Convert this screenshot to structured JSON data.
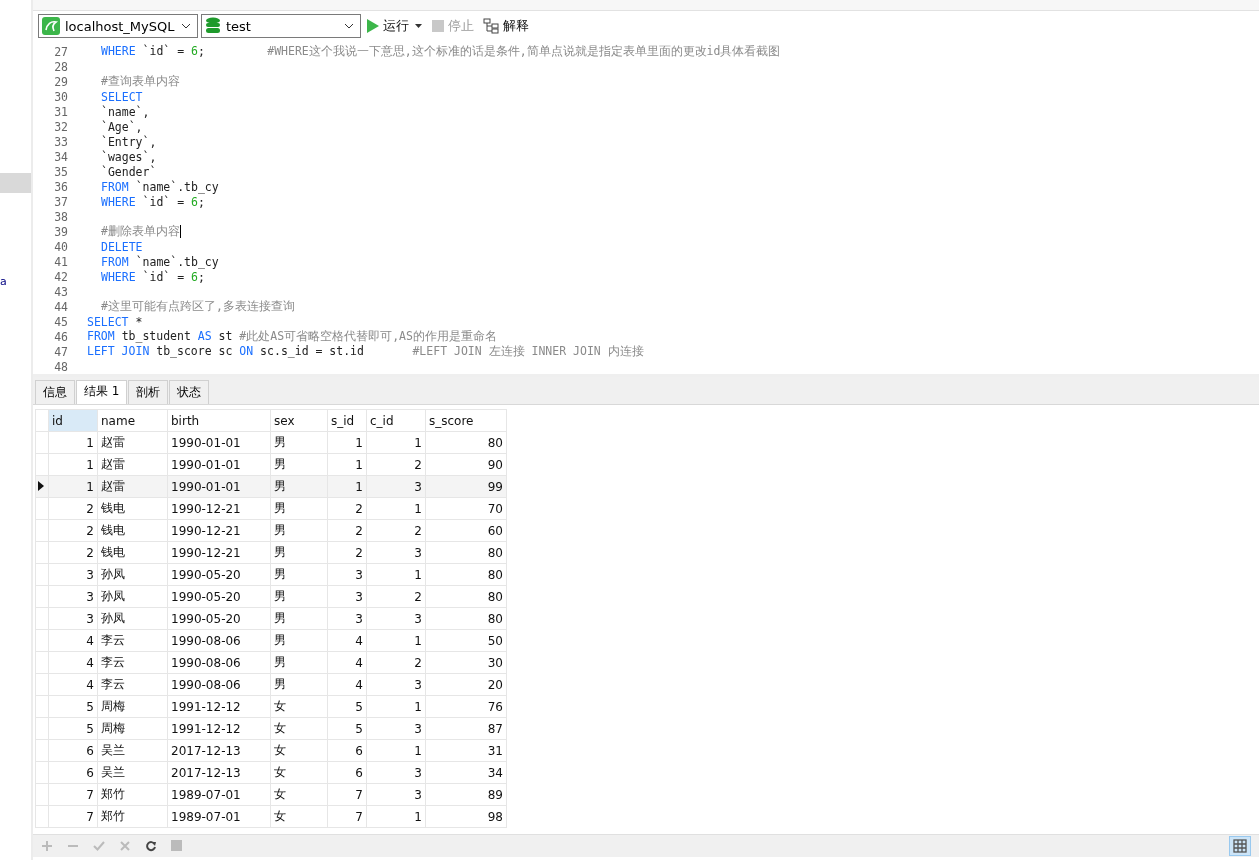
{
  "sidebar": {
    "fragment": "a"
  },
  "toolbar": {
    "connection": "localhost_MySQL",
    "database": "test",
    "run": "运行",
    "stop": "停止",
    "explain": "解释"
  },
  "editor": {
    "lines": [
      {
        "no": "27",
        "indent": true,
        "tokens": [
          {
            "kind": "keyword",
            "text": "WHERE"
          },
          {
            "kind": "plain",
            "text": " `id` = "
          },
          {
            "kind": "number",
            "text": "6"
          },
          {
            "kind": "plain",
            "text": ";         "
          },
          {
            "kind": "comment",
            "text": "#WHERE这个我说一下意思,这个标准的话是条件,简单点说就是指定表单里面的更改id具体看截图"
          }
        ]
      },
      {
        "no": "28"
      },
      {
        "no": "29",
        "indent": true,
        "tokens": [
          {
            "kind": "comment",
            "text": "#查询表单内容"
          }
        ]
      },
      {
        "no": "30",
        "indent": true,
        "tokens": [
          {
            "kind": "keyword",
            "text": "SELECT"
          }
        ]
      },
      {
        "no": "31",
        "indent": true,
        "tokens": [
          {
            "kind": "plain",
            "text": "`name`,"
          }
        ]
      },
      {
        "no": "32",
        "indent": true,
        "tokens": [
          {
            "kind": "plain",
            "text": "`Age`,"
          }
        ]
      },
      {
        "no": "33",
        "indent": true,
        "tokens": [
          {
            "kind": "plain",
            "text": "`Entry`,"
          }
        ]
      },
      {
        "no": "34",
        "indent": true,
        "tokens": [
          {
            "kind": "plain",
            "text": "`wages`,"
          }
        ]
      },
      {
        "no": "35",
        "indent": true,
        "tokens": [
          {
            "kind": "plain",
            "text": "`Gender`"
          }
        ]
      },
      {
        "no": "36",
        "indent": true,
        "tokens": [
          {
            "kind": "keyword",
            "text": "FROM"
          },
          {
            "kind": "plain",
            "text": " `name`.tb_cy"
          }
        ]
      },
      {
        "no": "37",
        "indent": true,
        "tokens": [
          {
            "kind": "keyword",
            "text": "WHERE"
          },
          {
            "kind": "plain",
            "text": " `id` = "
          },
          {
            "kind": "number",
            "text": "6"
          },
          {
            "kind": "plain",
            "text": ";"
          }
        ]
      },
      {
        "no": "38"
      },
      {
        "no": "39",
        "indent": true,
        "cursor": true,
        "tokens": [
          {
            "kind": "comment",
            "text": "#删除表单内容"
          }
        ]
      },
      {
        "no": "40",
        "indent": true,
        "tokens": [
          {
            "kind": "keyword",
            "text": "DELETE"
          }
        ]
      },
      {
        "no": "41",
        "indent": true,
        "tokens": [
          {
            "kind": "keyword",
            "text": "FROM"
          },
          {
            "kind": "plain",
            "text": " `name`.tb_cy"
          }
        ]
      },
      {
        "no": "42",
        "indent": true,
        "tokens": [
          {
            "kind": "keyword",
            "text": "WHERE"
          },
          {
            "kind": "plain",
            "text": " `id` = "
          },
          {
            "kind": "number",
            "text": "6"
          },
          {
            "kind": "plain",
            "text": ";"
          }
        ]
      },
      {
        "no": "43"
      },
      {
        "no": "44",
        "indent": true,
        "tokens": [
          {
            "kind": "comment",
            "text": "#这里可能有点跨区了,多表连接查询"
          }
        ]
      },
      {
        "no": "45",
        "indent": false,
        "tokens": [
          {
            "kind": "keyword",
            "text": "SELECT"
          },
          {
            "kind": "plain",
            "text": " *"
          }
        ]
      },
      {
        "no": "46",
        "indent": false,
        "tokens": [
          {
            "kind": "keyword",
            "text": "FROM"
          },
          {
            "kind": "plain",
            "text": " tb_student "
          },
          {
            "kind": "keyword",
            "text": "AS"
          },
          {
            "kind": "plain",
            "text": " st "
          },
          {
            "kind": "comment",
            "text": "#此处AS可省略空格代替即可,AS的作用是重命名"
          }
        ]
      },
      {
        "no": "47",
        "indent": false,
        "tokens": [
          {
            "kind": "keyword",
            "text": "LEFT JOIN"
          },
          {
            "kind": "plain",
            "text": " tb_score sc "
          },
          {
            "kind": "keyword",
            "text": "ON"
          },
          {
            "kind": "plain",
            "text": " sc.s_id = st.id       "
          },
          {
            "kind": "comment",
            "text": "#LEFT JOIN 左连接 INNER JOIN 内连接"
          }
        ]
      },
      {
        "no": "48"
      }
    ]
  },
  "tabs": [
    {
      "label": "信息",
      "selected": false
    },
    {
      "label": "结果 1",
      "selected": true
    },
    {
      "label": "剖析",
      "selected": false
    },
    {
      "label": "状态",
      "selected": false
    }
  ],
  "table": {
    "columns": [
      {
        "label": "id",
        "kind": "number",
        "selected": true
      },
      {
        "label": "name",
        "kind": "text",
        "selected": false
      },
      {
        "label": "birth",
        "kind": "text",
        "selected": false
      },
      {
        "label": "sex",
        "kind": "text",
        "selected": false
      },
      {
        "label": "s_id",
        "kind": "number",
        "selected": false
      },
      {
        "label": "c_id",
        "kind": "number",
        "selected": false
      },
      {
        "label": "s_score",
        "kind": "number",
        "selected": false
      }
    ],
    "rows": [
      {
        "selected": false,
        "cells": [
          "1",
          "赵雷",
          "1990-01-01",
          "男",
          "1",
          "1",
          "80"
        ]
      },
      {
        "selected": false,
        "cells": [
          "1",
          "赵雷",
          "1990-01-01",
          "男",
          "1",
          "2",
          "90"
        ]
      },
      {
        "selected": true,
        "cells": [
          "1",
          "赵雷",
          "1990-01-01",
          "男",
          "1",
          "3",
          "99"
        ]
      },
      {
        "selected": false,
        "cells": [
          "2",
          "钱电",
          "1990-12-21",
          "男",
          "2",
          "1",
          "70"
        ]
      },
      {
        "selected": false,
        "cells": [
          "2",
          "钱电",
          "1990-12-21",
          "男",
          "2",
          "2",
          "60"
        ]
      },
      {
        "selected": false,
        "cells": [
          "2",
          "钱电",
          "1990-12-21",
          "男",
          "2",
          "3",
          "80"
        ]
      },
      {
        "selected": false,
        "cells": [
          "3",
          "孙凤",
          "1990-05-20",
          "男",
          "3",
          "1",
          "80"
        ]
      },
      {
        "selected": false,
        "cells": [
          "3",
          "孙凤",
          "1990-05-20",
          "男",
          "3",
          "2",
          "80"
        ]
      },
      {
        "selected": false,
        "cells": [
          "3",
          "孙凤",
          "1990-05-20",
          "男",
          "3",
          "3",
          "80"
        ]
      },
      {
        "selected": false,
        "cells": [
          "4",
          "李云",
          "1990-08-06",
          "男",
          "4",
          "1",
          "50"
        ]
      },
      {
        "selected": false,
        "cells": [
          "4",
          "李云",
          "1990-08-06",
          "男",
          "4",
          "2",
          "30"
        ]
      },
      {
        "selected": false,
        "cells": [
          "4",
          "李云",
          "1990-08-06",
          "男",
          "4",
          "3",
          "20"
        ]
      },
      {
        "selected": false,
        "cells": [
          "5",
          "周梅",
          "1991-12-12",
          "女",
          "5",
          "1",
          "76"
        ]
      },
      {
        "selected": false,
        "cells": [
          "5",
          "周梅",
          "1991-12-12",
          "女",
          "5",
          "3",
          "87"
        ]
      },
      {
        "selected": false,
        "cells": [
          "6",
          "吴兰",
          "2017-12-13",
          "女",
          "6",
          "1",
          "31"
        ]
      },
      {
        "selected": false,
        "cells": [
          "6",
          "吴兰",
          "2017-12-13",
          "女",
          "6",
          "3",
          "34"
        ]
      },
      {
        "selected": false,
        "cells": [
          "7",
          "郑竹",
          "1989-07-01",
          "女",
          "7",
          "3",
          "89"
        ]
      },
      {
        "selected": false,
        "cells": [
          "7",
          "郑竹",
          "1989-07-01",
          "女",
          "7",
          "1",
          "98"
        ]
      }
    ]
  }
}
